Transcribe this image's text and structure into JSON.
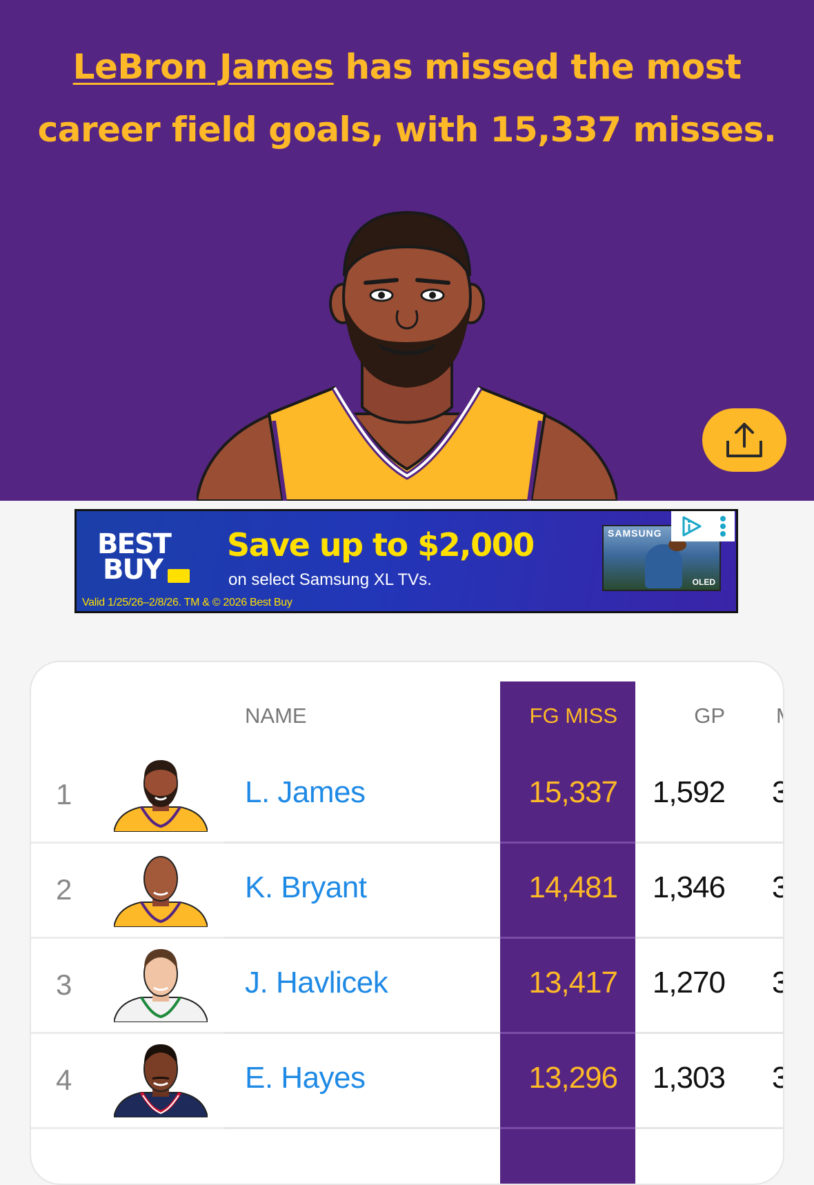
{
  "hero": {
    "player_link": "LeBron James",
    "headline_rest": " has missed the most career field goals, with 15,337 misses.",
    "colors": {
      "background": "#552583",
      "accent": "#fdb927"
    },
    "share_icon": "share-upload-icon"
  },
  "ad": {
    "brand_line1": "BEST",
    "brand_line2": "BUY",
    "headline": "Save up to $2,000",
    "subtext": "on select Samsung XL TVs.",
    "legal": "Valid 1/25/26–2/8/26. TM & © 2026 Best Buy",
    "tv_brand": "SAMSUNG",
    "tv_badge": "OLED",
    "icons": [
      "ad-choices-icon",
      "ad-menu-icon"
    ]
  },
  "table": {
    "headers": {
      "name": "NAME",
      "fg_miss": "FG MISS",
      "gp": "GP",
      "next": "M"
    },
    "rows": [
      {
        "rank": "1",
        "name": "L. James",
        "fg_miss": "15,337",
        "gp": "1,592",
        "next": "3"
      },
      {
        "rank": "2",
        "name": "K. Bryant",
        "fg_miss": "14,481",
        "gp": "1,346",
        "next": "3"
      },
      {
        "rank": "3",
        "name": "J. Havlicek",
        "fg_miss": "13,417",
        "gp": "1,270",
        "next": "3"
      },
      {
        "rank": "4",
        "name": "E. Hayes",
        "fg_miss": "13,296",
        "gp": "1,303",
        "next": "3"
      }
    ],
    "colors": {
      "sorted_column": "#552583",
      "sorted_text": "#fdb927",
      "name_link": "#1f8ae5"
    }
  }
}
